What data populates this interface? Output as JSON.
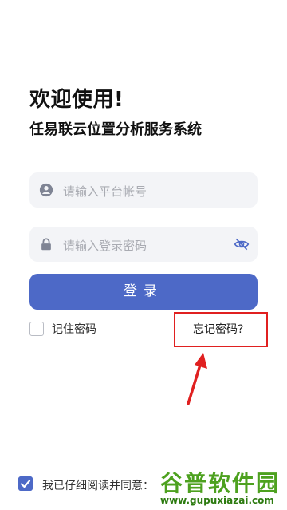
{
  "header": {
    "welcome": "欢迎使用!",
    "subtitle": "任易联云位置分析服务系统"
  },
  "form": {
    "account_placeholder": "请输入平台帐号",
    "password_placeholder": "请输入登录密码",
    "login_label": "登录",
    "remember_label": "记住密码",
    "remember_checked": false,
    "forgot_label": "忘记密码?"
  },
  "footer": {
    "agreement_label": "我已仔细阅读并同意：",
    "agreement_checked": true
  },
  "watermark": {
    "title": "谷普软件园",
    "url": "www.gupuxiazai.com"
  },
  "colors": {
    "primary": "#4d69c7",
    "annotation_red": "#e02020",
    "field_bg": "#f3f4f7"
  }
}
